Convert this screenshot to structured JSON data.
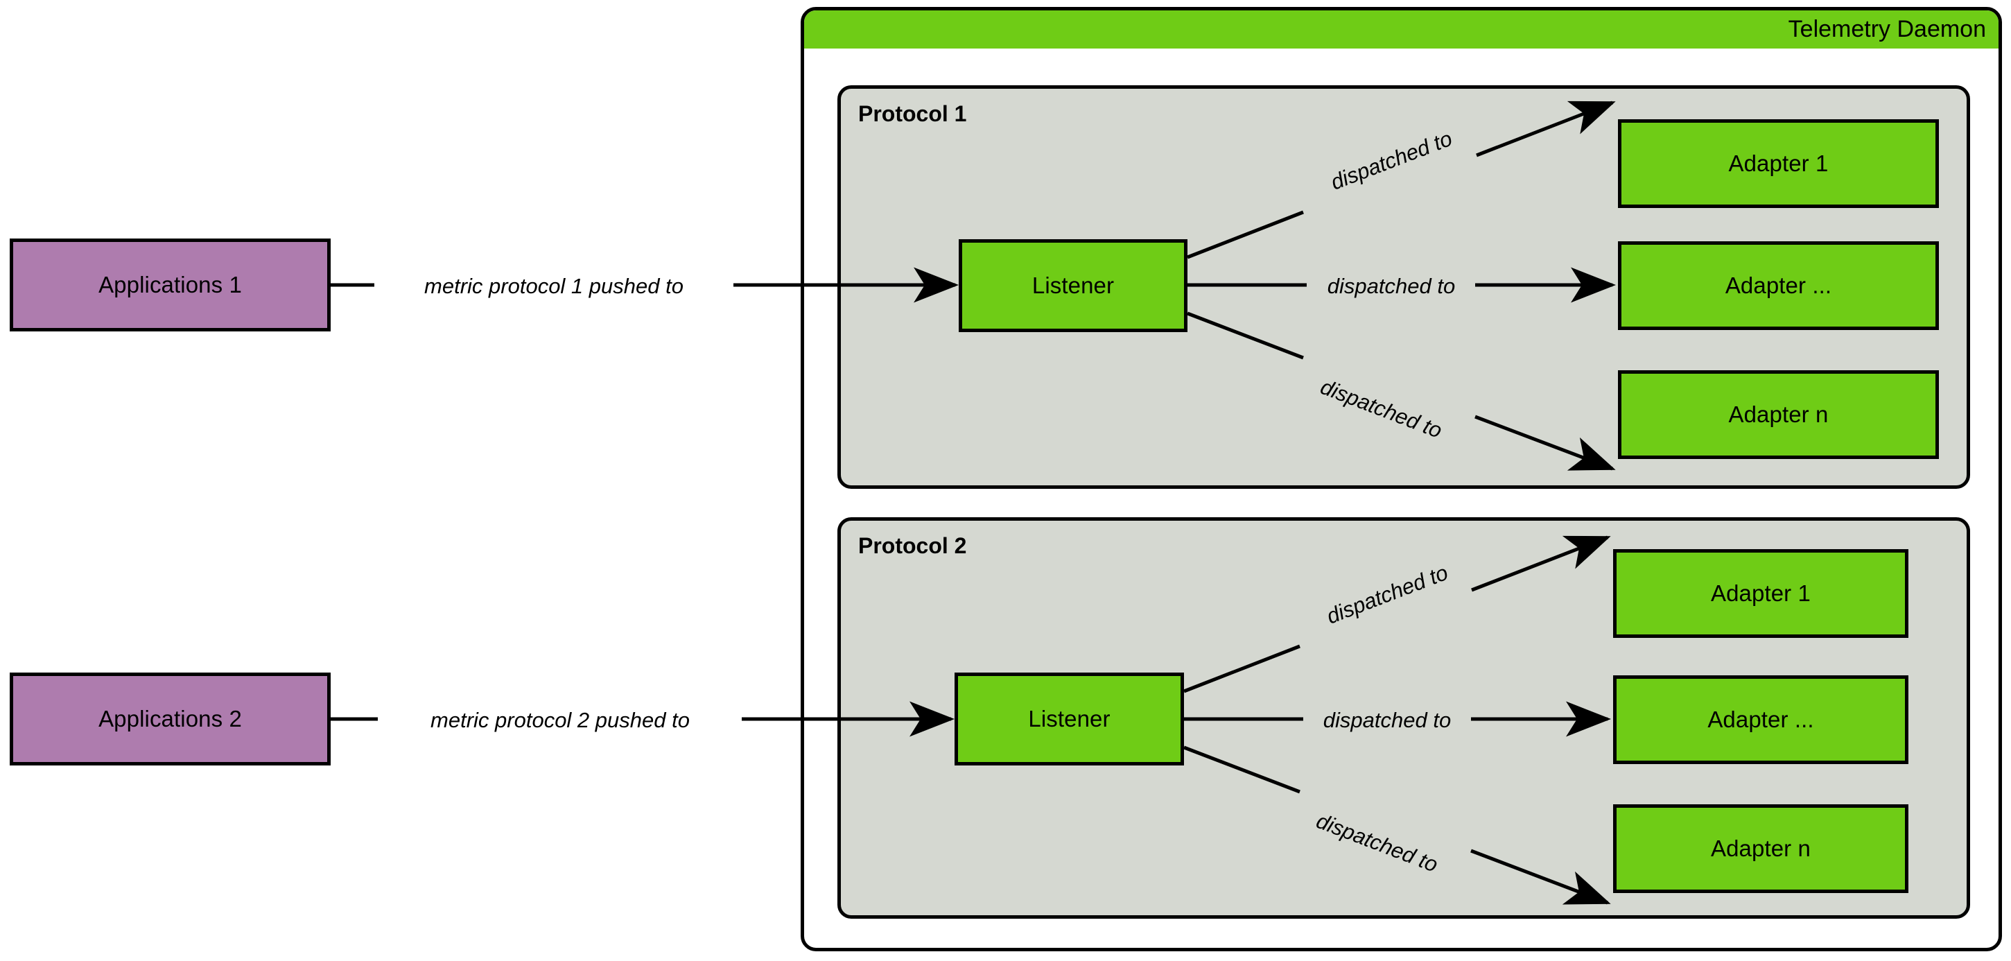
{
  "daemon": {
    "title": "Telemetry Daemon",
    "header_color": "#6FCC16"
  },
  "colors": {
    "green": "#6FCC16",
    "purple": "#AE7CAE",
    "group_gray": "#D5D8D1",
    "stroke": "#000000",
    "background": "#FFFFFF"
  },
  "applications": [
    {
      "label": "Applications 1"
    },
    {
      "label": "Applications 2"
    }
  ],
  "flow_labels": [
    {
      "text": "metric protocol 1 pushed to"
    },
    {
      "text": "metric protocol 2 pushed to"
    }
  ],
  "protocols": [
    {
      "label": "Protocol 1",
      "listener": {
        "label": "Listener"
      },
      "dispatch_labels": [
        {
          "text": "dispatched to"
        },
        {
          "text": "dispatched to"
        },
        {
          "text": "dispatched to"
        }
      ],
      "adapters": [
        {
          "label": "Adapter 1"
        },
        {
          "label": "Adapter ..."
        },
        {
          "label": "Adapter n"
        }
      ]
    },
    {
      "label": "Protocol 2",
      "listener": {
        "label": "Listener"
      },
      "dispatch_labels": [
        {
          "text": "dispatched to"
        },
        {
          "text": "dispatched to"
        },
        {
          "text": "dispatched to"
        }
      ],
      "adapters": [
        {
          "label": "Adapter 1"
        },
        {
          "label": "Adapter ..."
        },
        {
          "label": "Adapter n"
        }
      ]
    }
  ]
}
